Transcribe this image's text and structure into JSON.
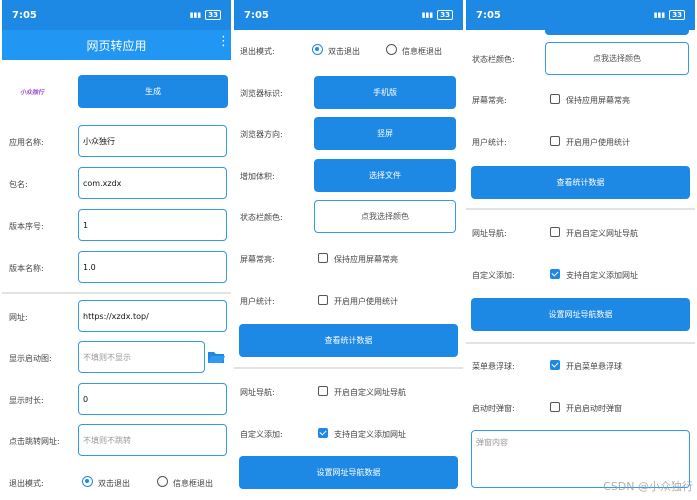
{
  "status": {
    "time": "7:05",
    "battery": "33"
  },
  "p1": {
    "title": "网页转应用",
    "logo_text": "小众独行",
    "generate": "生成",
    "app_name_label": "应用名称:",
    "app_name_value": "小众独行",
    "package_label": "包名:",
    "package_value": "com.xzdx",
    "version_code_label": "版本序号:",
    "version_code_value": "1",
    "version_name_label": "版本名称:",
    "version_name_value": "1.0",
    "url_label": "网址:",
    "url_value": "https://xzdx.top/",
    "splash_label": "显示启动图:",
    "splash_placeholder": "不填则不显示",
    "duration_label": "显示时长:",
    "duration_value": "0",
    "click_url_label": "点击跳转网址:",
    "click_url_placeholder": "不填则不跳转",
    "exit_label": "退出模式:",
    "exit_opt1": "双击退出",
    "exit_opt2": "信息框退出"
  },
  "p2": {
    "exit_label": "退出模式:",
    "exit_opt1": "双击退出",
    "exit_opt2": "信息框退出",
    "ua_label": "浏览器标识:",
    "ua_button": "手机版",
    "orient_label": "浏览器方向:",
    "orient_button": "竖屏",
    "size_label": "增加体积:",
    "size_button": "选择文件",
    "color_label": "状态栏颜色:",
    "color_button": "点我选择颜色",
    "screen_label": "屏幕常亮:",
    "screen_cb": "保持应用屏幕常亮",
    "stats_label": "用户统计:",
    "stats_cb": "开启用户使用统计",
    "stats_button": "查看统计数据",
    "nav_label": "网址导航:",
    "nav_cb": "开启自定义网址导航",
    "custom_label": "自定义添加:",
    "custom_cb": "支持自定义添加网址",
    "nav_button": "设置网址导航数据"
  },
  "p3": {
    "color_label": "状态栏颜色:",
    "color_button": "点我选择颜色",
    "screen_label": "屏幕常亮:",
    "screen_cb": "保持应用屏幕常亮",
    "stats_label": "用户统计:",
    "stats_cb": "开启用户使用统计",
    "stats_button": "查看统计数据",
    "nav_label": "网址导航:",
    "nav_cb": "开启自定义网址导航",
    "custom_label": "自定义添加:",
    "custom_cb": "支持自定义添加网址",
    "nav_button": "设置网址导航数据",
    "float_label": "菜单悬浮球:",
    "float_cb": "开启菜单悬浮球",
    "popup_label": "启动时弹窗:",
    "popup_cb": "开启启动时弹窗",
    "popup_placeholder": "弹窗内容"
  },
  "watermark": "CSDN @小众独行"
}
